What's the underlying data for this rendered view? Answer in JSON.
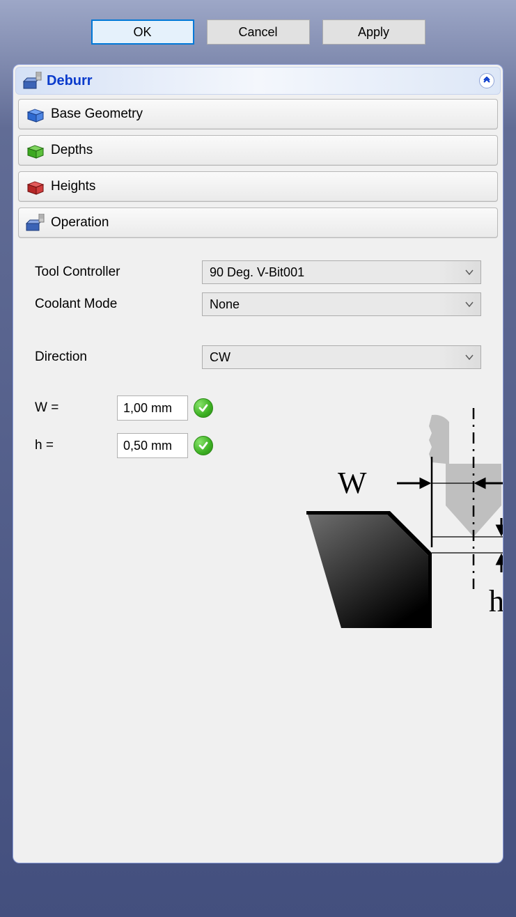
{
  "buttons": {
    "ok": "OK",
    "cancel": "Cancel",
    "apply": "Apply"
  },
  "header": {
    "title": "Deburr"
  },
  "sections": {
    "base_geometry": "Base Geometry",
    "depths": "Depths",
    "heights": "Heights",
    "operation": "Operation"
  },
  "form": {
    "tool_controller": {
      "label": "Tool Controller",
      "value": "90 Deg. V-Bit001"
    },
    "coolant_mode": {
      "label": "Coolant Mode",
      "value": "None"
    },
    "direction": {
      "label": "Direction",
      "value": "CW"
    },
    "w": {
      "label": "W =",
      "value": "1,00 mm"
    },
    "h": {
      "label": "h =",
      "value": "0,50 mm"
    }
  },
  "diagram": {
    "w_label": "W",
    "h_label": "h"
  }
}
